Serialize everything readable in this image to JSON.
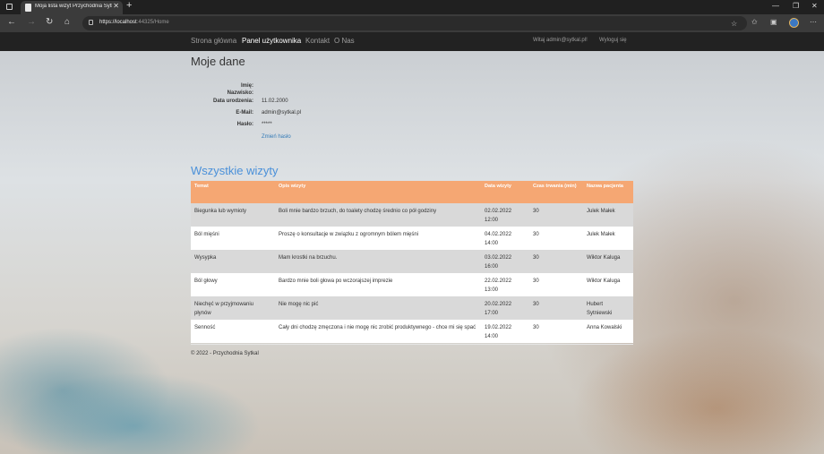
{
  "browser": {
    "tab_title": "Moja lista wizyt Przychodnia Sytkal",
    "url_host": "https://localhost",
    "url_rest": ":44325/Home"
  },
  "nav": {
    "home": "Strona główna",
    "panel": "Panel użytkownika",
    "contact": "Kontakt",
    "about": "O Nas",
    "greeting": "Witaj admin@sytkal.pl!",
    "logout": "Wyloguj się"
  },
  "profile": {
    "heading": "Moje dane",
    "first_name_label": "Imię:",
    "first_name": "",
    "last_name_label": "Nazwisko:",
    "last_name": "",
    "dob_label": "Data urodzenia:",
    "dob": "11.02.2000",
    "email_label": "E-Mail:",
    "email": "admin@sytkal.pl",
    "password_label": "Hasło:",
    "password": "*****",
    "change_password": "Zmień hasło"
  },
  "visits": {
    "heading": "Wszystkie wizyty",
    "headers": [
      "Temat",
      "Opis wizyty",
      "Data wizyty",
      "Czas trwania (min)",
      "Nazwa pacjenta"
    ],
    "rows": [
      {
        "topic": "Biegunka lub wymioty",
        "desc": "Boli mnie bardzo brzuch, do toalety chodzę średnio co pół godziny",
        "date": "02.02.2022 12:00",
        "duration": "30",
        "patient": "Julek Małek"
      },
      {
        "topic": "Ból mięśni",
        "desc": "Proszę o konsultacje w związku z ogromnym bólem mięśni",
        "date": "04.02.2022 14:00",
        "duration": "30",
        "patient": "Julek Małek"
      },
      {
        "topic": "Wysypka",
        "desc": "Mam krostki na brzuchu.",
        "date": "03.02.2022 16:00",
        "duration": "30",
        "patient": "Wiktor Kaluga"
      },
      {
        "topic": "Ból głowy",
        "desc": "Bardzo mnie boli głowa po wczorajszej imprezie",
        "date": "22.02.2022 13:00",
        "duration": "30",
        "patient": "Wiktor Kaluga"
      },
      {
        "topic": "Niechęć w przyjmowaniu płynów",
        "desc": "Nie mogę nic pić",
        "date": "20.02.2022 17:00",
        "duration": "30",
        "patient": "Hubert Sytniewski"
      },
      {
        "topic": "Senność",
        "desc": "Cały dni chodzę zmęczona i nie mogę nic zrobić produktywnego - chce mi się spać",
        "date": "19.02.2022 14:00",
        "duration": "30",
        "patient": "Anna Kowalski"
      }
    ]
  },
  "footer": "© 2022 - Przychodnia Sytkal"
}
